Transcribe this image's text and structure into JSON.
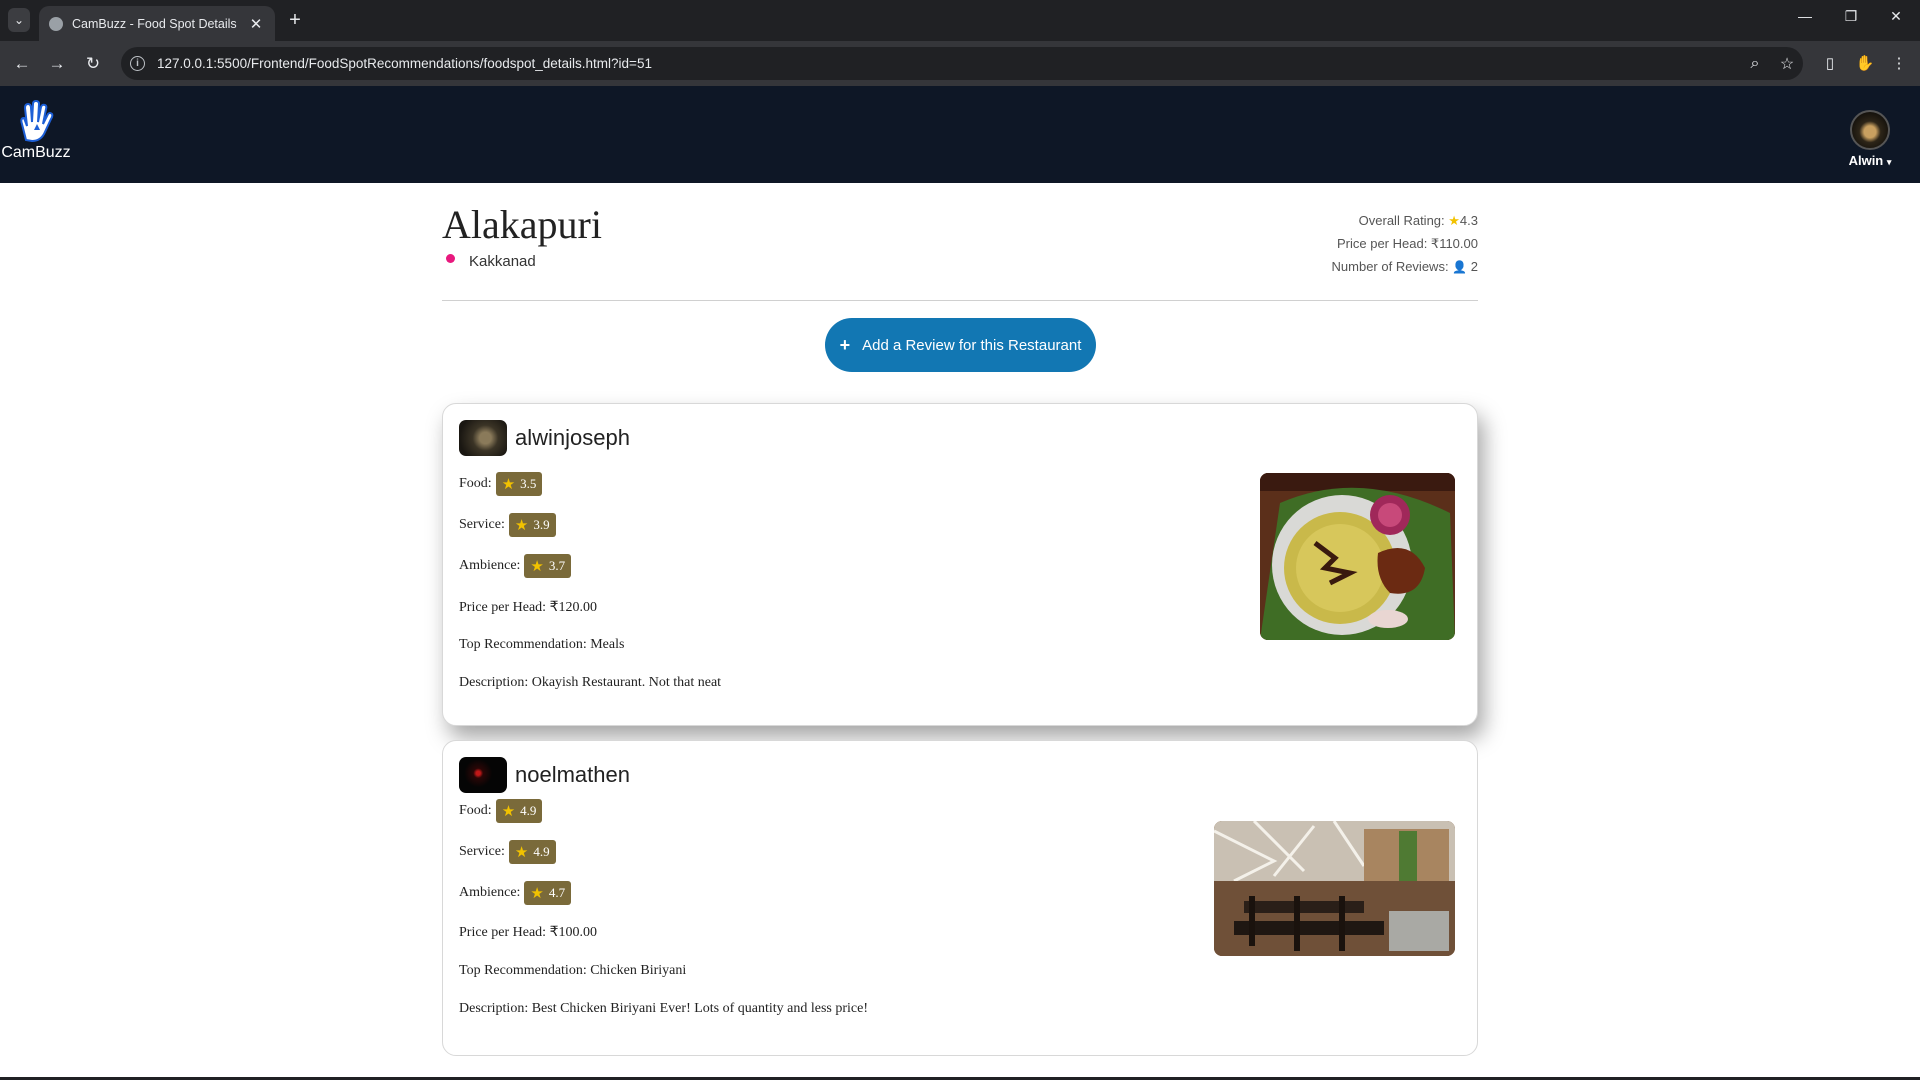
{
  "browser": {
    "tab_title": "CamBuzz - Food Spot Details",
    "url": "127.0.0.1:5500/Frontend/FoodSpotRecommendations/foodspot_details.html?id=51"
  },
  "header": {
    "brand": "CamBuzz",
    "user_name": "Alwin"
  },
  "restaurant": {
    "name": "Alakapuri",
    "location": "Kakkanad",
    "overall_rating_label": "Overall Rating:",
    "overall_rating": "4.3",
    "price_label": "Price per Head: ₹110.00",
    "reviews_label": "Number of Reviews:",
    "reviews_count": "2"
  },
  "add_review_label": "Add a Review for this Restaurant",
  "reviews": [
    {
      "username": "alwinjoseph",
      "food_label": "Food:",
      "food": "3.5",
      "service_label": "Service:",
      "service": "3.9",
      "ambience_label": "Ambience:",
      "ambience": "3.7",
      "price": "Price per Head: ₹120.00",
      "top": "Top Recommendation: Meals",
      "description": "Description: Okayish Restaurant. Not that neat"
    },
    {
      "username": "noelmathen",
      "food_label": "Food:",
      "food": "4.9",
      "service_label": "Service:",
      "service": "4.9",
      "ambience_label": "Ambience:",
      "ambience": "4.7",
      "price": "Price per Head: ₹100.00",
      "top": "Top Recommendation: Chicken Biriyani",
      "description": "Description: Best Chicken Biriyani Ever! Lots of quantity and less price!"
    }
  ],
  "colors": {
    "header_bg": "#0e1726",
    "button_bg": "#1277b3",
    "rating_badge": "#7a6a3a",
    "star": "#f2c200",
    "pin": "#e8197e"
  }
}
